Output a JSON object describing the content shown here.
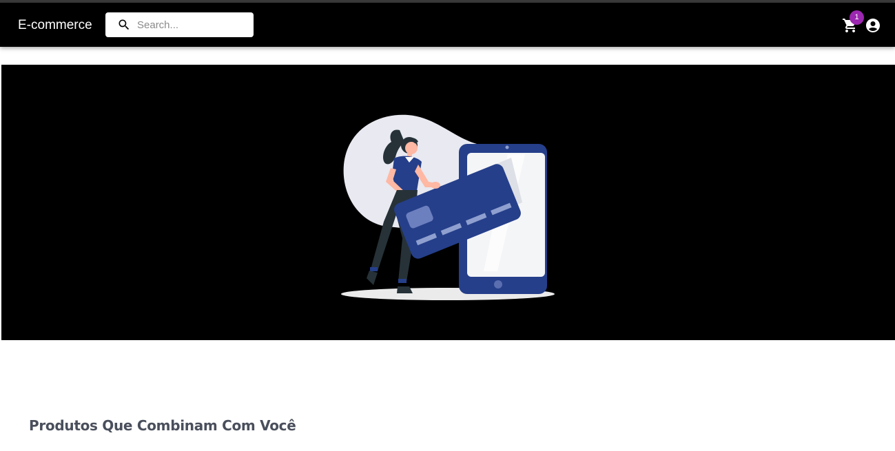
{
  "header": {
    "brand": "E-commerce",
    "search": {
      "placeholder": "Search...",
      "value": ""
    },
    "cart": {
      "badge_count": "1",
      "badge_color": "#9c27b0"
    },
    "icons": [
      "search-icon",
      "shopping-cart-icon",
      "account-circle-icon"
    ]
  },
  "hero": {
    "illustration": "woman-with-credit-card-and-smartphone",
    "background_color": "#000000",
    "accent_color": "#253f8a"
  },
  "main": {
    "section_title": "Produtos Que Combinam Com Você"
  }
}
